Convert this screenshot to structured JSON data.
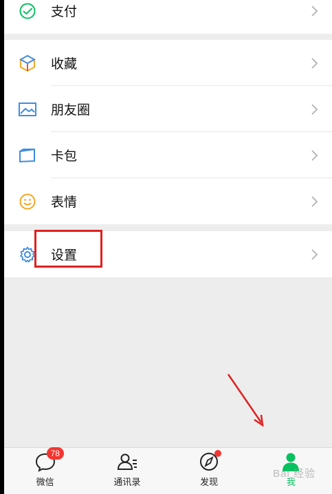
{
  "menu": {
    "group1": [
      {
        "label": "支付",
        "icon": "wallet-check-icon"
      }
    ],
    "group2": [
      {
        "label": "收藏",
        "icon": "favorites-cube-icon"
      },
      {
        "label": "朋友圈",
        "icon": "moments-photo-icon"
      },
      {
        "label": "卡包",
        "icon": "card-wallet-icon"
      },
      {
        "label": "表情",
        "icon": "smiley-icon"
      }
    ],
    "group3": [
      {
        "label": "设置",
        "icon": "gear-icon"
      }
    ]
  },
  "tabbar": {
    "tabs": [
      {
        "label": "微信",
        "badge": "78"
      },
      {
        "label": "通讯录"
      },
      {
        "label": "发现"
      },
      {
        "label": "我"
      }
    ]
  },
  "watermark": "Bai 经验",
  "colors": {
    "accent": "#07c160",
    "highlight": "#e02020",
    "badge": "#f43530"
  }
}
